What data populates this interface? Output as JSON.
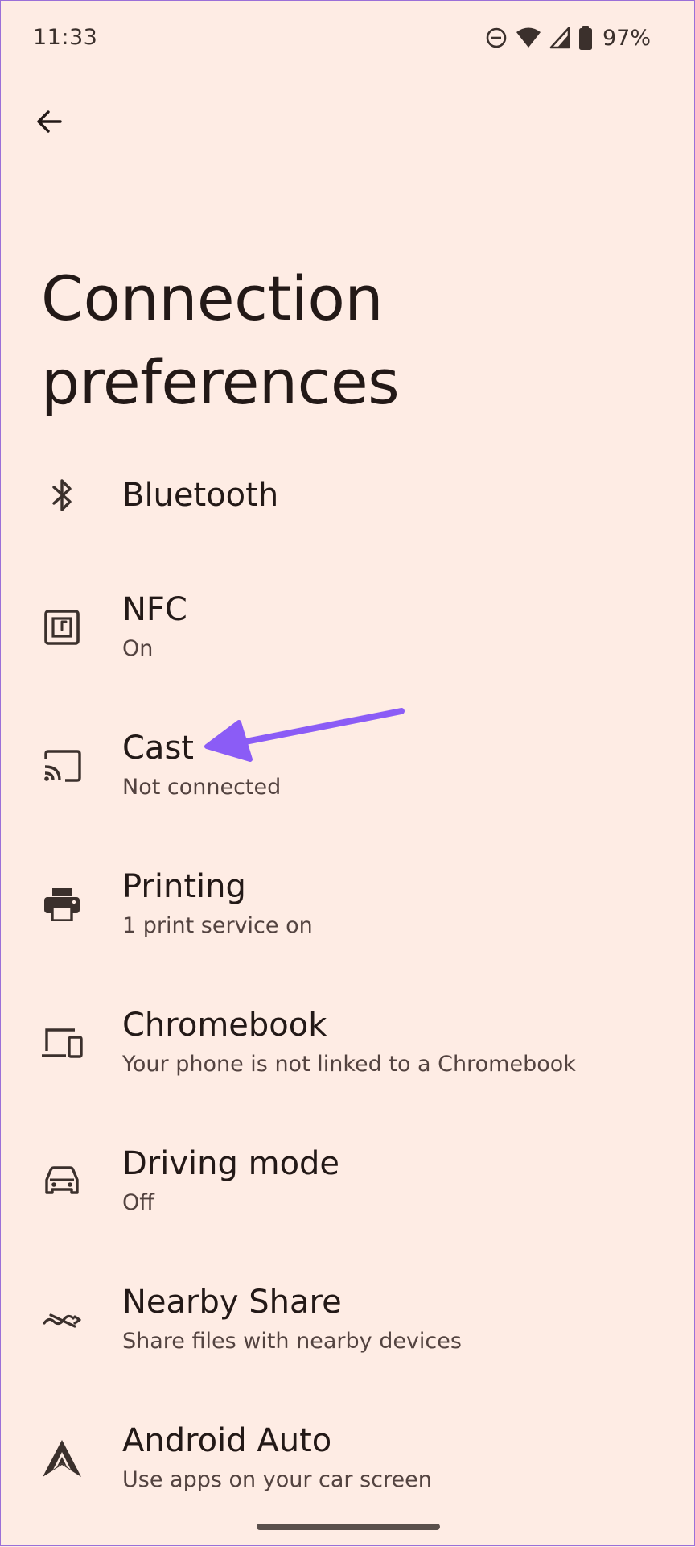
{
  "status_bar": {
    "time": "11:33",
    "battery_percent": "97%",
    "icons": [
      "do-not-disturb-icon",
      "wifi-icon",
      "cell-signal-icon",
      "battery-icon"
    ]
  },
  "header": {
    "back_icon": "arrow-back-icon",
    "title": "Connection preferences"
  },
  "settings": [
    {
      "id": "bluetooth",
      "icon": "bluetooth-icon",
      "title": "Bluetooth",
      "subtitle": ""
    },
    {
      "id": "nfc",
      "icon": "nfc-icon",
      "title": "NFC",
      "subtitle": "On"
    },
    {
      "id": "cast",
      "icon": "cast-icon",
      "title": "Cast",
      "subtitle": "Not connected"
    },
    {
      "id": "printing",
      "icon": "printer-icon",
      "title": "Printing",
      "subtitle": "1 print service on"
    },
    {
      "id": "chromebook",
      "icon": "devices-icon",
      "title": "Chromebook",
      "subtitle": "Your phone is not linked to a Chromebook"
    },
    {
      "id": "driving-mode",
      "icon": "car-icon",
      "title": "Driving mode",
      "subtitle": "Off"
    },
    {
      "id": "nearby-share",
      "icon": "nearby-share-icon",
      "title": "Nearby Share",
      "subtitle": "Share files with nearby devices"
    },
    {
      "id": "android-auto",
      "icon": "android-auto-icon",
      "title": "Android Auto",
      "subtitle": "Use apps on your car screen"
    }
  ],
  "colors": {
    "background": "#FEECE4",
    "text_primary": "#231917",
    "text_secondary": "#534340",
    "icon": "#3b302c",
    "annotation_arrow": "#8B5CF6"
  }
}
